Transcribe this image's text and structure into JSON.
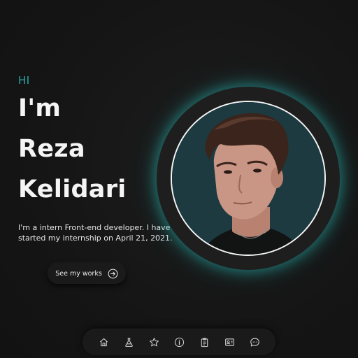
{
  "hero": {
    "greeting": "HI",
    "name_line_1": "I'm",
    "name_line_2": "Reza",
    "name_line_3": "Kelidari",
    "bio": "I'm a intern Front-end developer. I have started my internship on April 21, 2021."
  },
  "cta": {
    "label": "See my works",
    "icon": "arrow-right-circle-icon"
  },
  "portrait": {
    "icon": "profile-photo",
    "glow_color": "#2ac8c3"
  },
  "nav": {
    "items": [
      {
        "icon": "home-icon"
      },
      {
        "icon": "flask-icon"
      },
      {
        "icon": "star-icon"
      },
      {
        "icon": "info-icon"
      },
      {
        "icon": "clipboard-icon"
      },
      {
        "icon": "contact-card-icon"
      },
      {
        "icon": "chat-icon"
      }
    ]
  },
  "colors": {
    "accent": "#2aa7a3",
    "background": "#161616"
  }
}
